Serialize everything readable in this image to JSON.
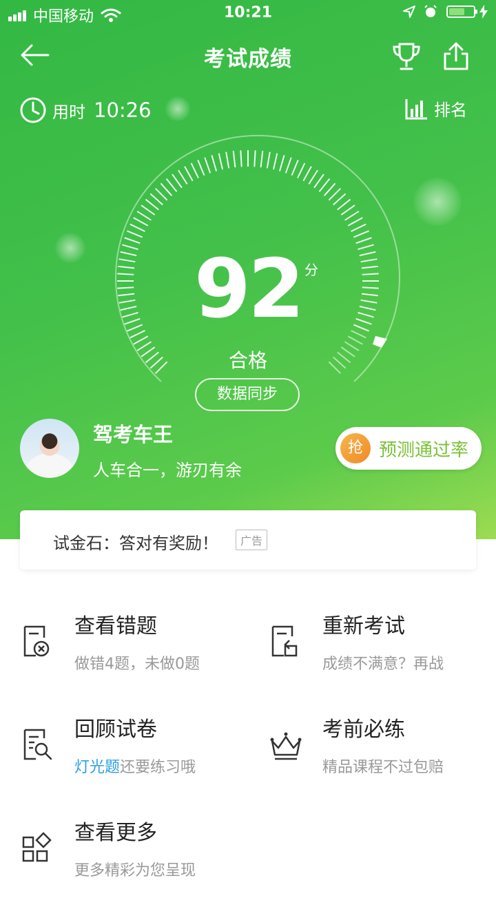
{
  "status_bar": {
    "carrier": "中国移动",
    "time": "10:21"
  },
  "nav": {
    "title": "考试成绩"
  },
  "stats": {
    "time_label": "用时",
    "time_value": "10:26",
    "rank_label": "排名"
  },
  "result": {
    "score": "92",
    "unit": "分",
    "status": "合格",
    "sync_label": "数据同步"
  },
  "user": {
    "name": "驾考车王",
    "motto": "人车合一，游刃有余"
  },
  "predict": {
    "badge": "抢",
    "label": "预测通过率"
  },
  "ad": {
    "text": "试金石：答对有奖励！",
    "tag": "广告"
  },
  "menu": [
    {
      "title": "查看错题",
      "subtitle": "做错4题，未做0题",
      "icon": "wrong-questions-icon"
    },
    {
      "title": "重新考试",
      "subtitle": "成绩不满意？再战",
      "icon": "retake-exam-icon"
    },
    {
      "title": "回顾试卷",
      "subtitle_highlight": "灯光题",
      "subtitle": "还要练习哦",
      "icon": "review-paper-icon"
    },
    {
      "title": "考前必练",
      "subtitle": "精品课程不过包赔",
      "icon": "crown-icon"
    },
    {
      "title": "查看更多",
      "subtitle": "更多精彩为您呈现",
      "icon": "grid-more-icon"
    }
  ],
  "colors": {
    "hero_start": "#33b844",
    "hero_end": "#9ddc52",
    "accent_blue": "#2d9ee0",
    "predict_green": "#7ac036"
  }
}
